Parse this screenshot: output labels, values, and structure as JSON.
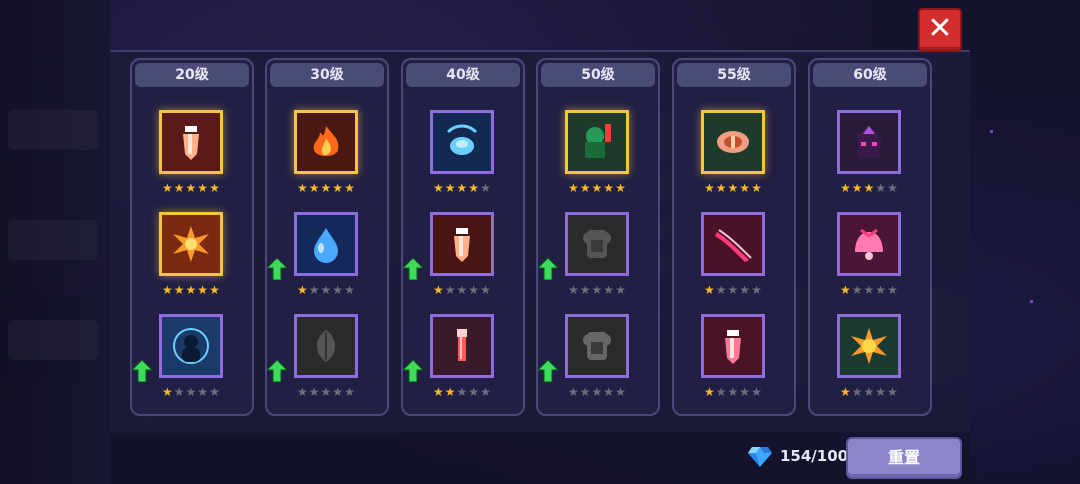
{
  "columns": [
    {
      "label": "20级",
      "slots": [
        {
          "icon": "crystal-sword-icon",
          "bg": "#5a1a1a",
          "color": "#ffb08a",
          "frame": "gold",
          "stars": 5,
          "upgrade": false
        },
        {
          "icon": "explosion-icon",
          "bg": "#7a2a10",
          "color": "#ff9a2a",
          "frame": "gold",
          "stars": 5,
          "upgrade": false
        },
        {
          "icon": "ghost-silhouette-icon",
          "bg": "#1a3a6a",
          "color": "#6ad0ff",
          "frame": "purple",
          "stars": 1,
          "upgrade": true
        }
      ]
    },
    {
      "label": "30级",
      "slots": [
        {
          "icon": "fire-icon",
          "bg": "#4a1a12",
          "color": "#ff6a1a",
          "frame": "gold",
          "stars": 5,
          "upgrade": false
        },
        {
          "icon": "water-drop-icon",
          "bg": "#14285a",
          "color": "#4aa8ff",
          "frame": "purple",
          "stars": 1,
          "upgrade": true
        },
        {
          "icon": "leaf-icon",
          "bg": "#2a2a2a",
          "color": "#555555",
          "frame": "purple",
          "stars": 0,
          "upgrade": true
        }
      ]
    },
    {
      "label": "40级",
      "slots": [
        {
          "icon": "blue-orb-icon",
          "bg": "#122a52",
          "color": "#6ad0ff",
          "frame": "purple",
          "stars": 4,
          "upgrade": false
        },
        {
          "icon": "crystal-sword-icon",
          "bg": "#4a1414",
          "color": "#ffb08a",
          "frame": "purple",
          "stars": 1,
          "upgrade": true
        },
        {
          "icon": "red-sword-icon",
          "bg": "#3a1a2a",
          "color": "#ff5a5a",
          "frame": "purple",
          "stars": 2,
          "upgrade": true
        }
      ]
    },
    {
      "label": "50级",
      "slots": [
        {
          "icon": "green-warrior-icon",
          "bg": "#1e3a2a",
          "color": "#2a9a5a",
          "frame": "gold",
          "stars": 5,
          "upgrade": false
        },
        {
          "icon": "grey-armor-icon",
          "bg": "#2a2a2a",
          "color": "#555555",
          "frame": "purple",
          "stars": 0,
          "upgrade": true
        },
        {
          "icon": "grey-armor-icon",
          "bg": "#2a2a2a",
          "color": "#666666",
          "frame": "purple",
          "stars": 0,
          "upgrade": true
        }
      ]
    },
    {
      "label": "55级",
      "slots": [
        {
          "icon": "eye-shield-icon",
          "bg": "#1e3a2a",
          "color": "#f0a080",
          "frame": "gold",
          "stars": 5,
          "upgrade": false
        },
        {
          "icon": "red-slash-icon",
          "bg": "#4a1228",
          "color": "#ff3a7a",
          "frame": "purple",
          "stars": 1,
          "upgrade": false
        },
        {
          "icon": "crystal-sword-icon",
          "bg": "#4a1428",
          "color": "#ff7a9a",
          "frame": "purple",
          "stars": 1,
          "upgrade": false
        }
      ]
    },
    {
      "label": "60级",
      "slots": [
        {
          "icon": "shadow-demon-icon",
          "bg": "#2a1a3a",
          "color": "#b050e0",
          "frame": "purple",
          "stars": 3,
          "upgrade": false
        },
        {
          "icon": "pink-bell-icon",
          "bg": "#4a1638",
          "color": "#ff7ab0",
          "frame": "purple",
          "stars": 1,
          "upgrade": false
        },
        {
          "icon": "sun-burst-icon",
          "bg": "#1a3a32",
          "color": "#ff9a2a",
          "frame": "purple",
          "stars": 1,
          "upgrade": false
        }
      ]
    }
  ],
  "footer": {
    "gems": "154/100",
    "reset_label": "重置"
  },
  "close_label": "✕",
  "colors": {
    "star_on": "#f6b92b",
    "star_off": "#6f6f7c",
    "upgrade_arrow": "#3ddc5a",
    "close": "#d42d2d",
    "reset": "#8b86c9"
  }
}
